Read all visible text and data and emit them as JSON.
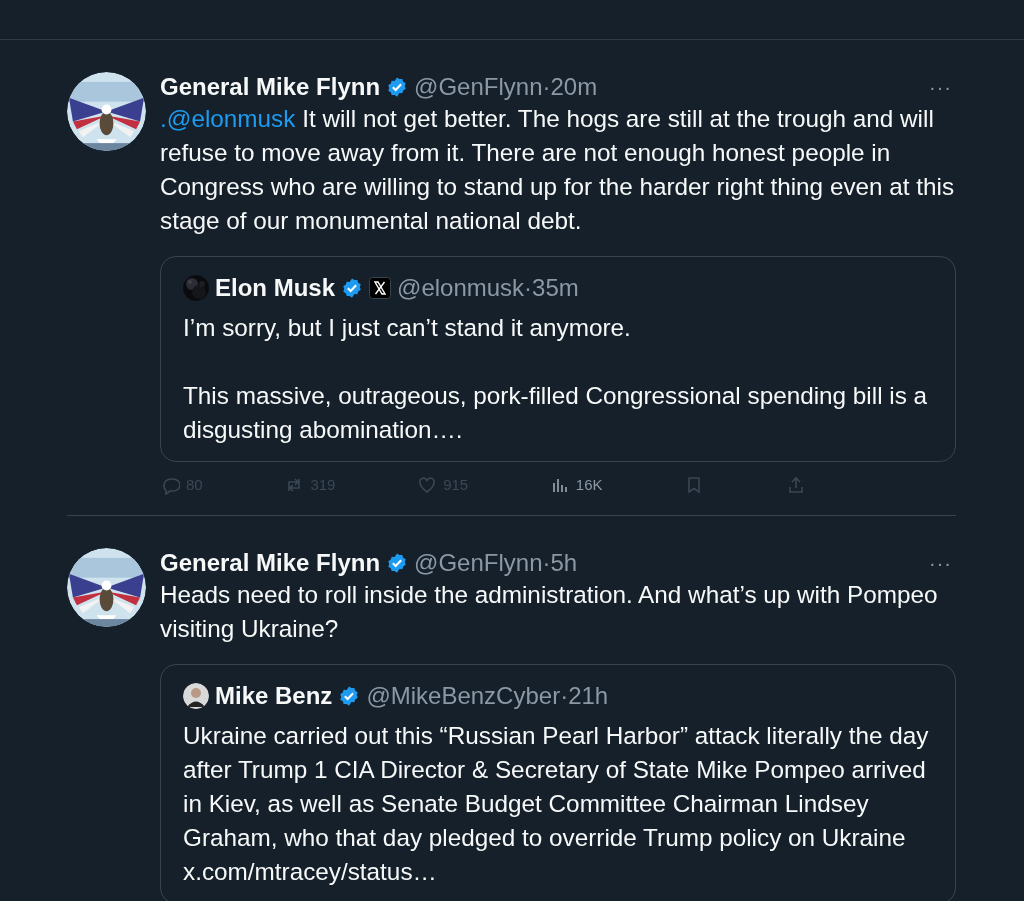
{
  "tweets": [
    {
      "author": {
        "name": "General Mike Flynn",
        "verified": true,
        "handle": "@GenFlynn",
        "separator": "·",
        "time": "20m"
      },
      "more": "···",
      "text": [
        {
          "kind": "link",
          "text": ".@elonmusk"
        },
        {
          "kind": "plain",
          "text": " It will not get better. The hogs are still at the trough and will refuse to move away from it. There are not enough honest people in Congress who are willing to stand up for the harder right thing even at this stage of our monumental national debt."
        }
      ],
      "quote": {
        "author": {
          "name": "Elon Musk",
          "verified": true,
          "affiliate": true,
          "handle": "@elonmusk",
          "separator": "·",
          "time": "35m"
        },
        "paragraphs": [
          "I’m sorry, but I just can’t stand it anymore.",
          "This massive, outrageous, pork-filled Congressional spending bill is a disgusting abomination…."
        ]
      },
      "actions": [
        {
          "kind": "reply",
          "count": "80"
        },
        {
          "kind": "repost",
          "count": "319"
        },
        {
          "kind": "like",
          "count": "915"
        },
        {
          "kind": "views",
          "count": "16K"
        },
        {
          "kind": "bookmark"
        },
        {
          "kind": "share"
        }
      ]
    },
    {
      "author": {
        "name": "General Mike Flynn",
        "verified": true,
        "handle": "@GenFlynn",
        "separator": "·",
        "time": "5h"
      },
      "more": "···",
      "text": [
        {
          "kind": "plain",
          "text": "Heads need to roll inside the administration. And what’s up with Pompeo visiting Ukraine?"
        }
      ],
      "quote": {
        "author": {
          "name": "Mike Benz",
          "verified": true,
          "handle": "@MikeBenzCyber",
          "separator": "·",
          "time": "21h"
        },
        "paragraphs": [
          "Ukraine carried out this “Russian Pearl Harbor” attack literally the day after Trump 1 CIA Director & Secretary of State Mike Pompeo arrived in Kiev, as well as Senate Budget Committee Chairman Lindsey Graham, who that day pledged to override Trump policy on Ukraine x.com/mtracey/status…"
        ]
      }
    }
  ]
}
